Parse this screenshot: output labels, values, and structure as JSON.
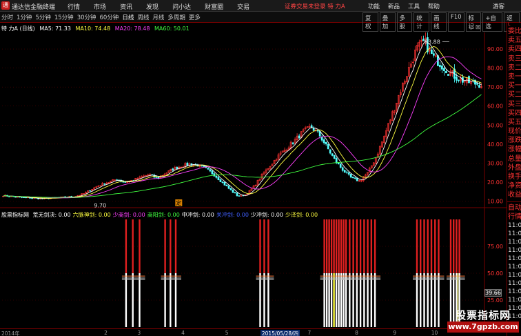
{
  "titlebar": {
    "logo": "通",
    "app_title": "通达信金融终端",
    "menu": [
      "行情",
      "市场",
      "资讯",
      "发现",
      "问小达",
      "财富圈",
      "交易"
    ],
    "notice": "证券交易未登录  特 力A",
    "right_menu": [
      "功能",
      "新品",
      "工具",
      "帮助"
    ],
    "guest": "游客"
  },
  "toolbar": {
    "periods": [
      "分时",
      "1分钟",
      "5分钟",
      "15分钟",
      "30分钟",
      "60分钟",
      "日线",
      "周线",
      "月线",
      "多周期",
      "更多"
    ],
    "active_period": "日线",
    "tools": [
      "复权",
      "叠加",
      "多股",
      "统计",
      "画线",
      "F10",
      "标记",
      "+自选",
      "返回"
    ]
  },
  "main_info": {
    "stock": "特 力A (日线)",
    "ma5": "MA5: 71.33",
    "ma10": "MA10: 74.48",
    "ma20": "MA20: 78.48",
    "ma60": "MA60: 50.01",
    "icons": "◇ ⊠"
  },
  "sub_info": {
    "indicator": "股票指标网",
    "items": [
      {
        "label": "荒无剑决: 0.00",
        "color": "#ffffff"
      },
      {
        "label": "六脉神剑: 0.00",
        "color": "#ffff40"
      },
      {
        "label": "少商剑: 0.00",
        "color": "#ff40ff"
      },
      {
        "label": "商阳剑: 0.00",
        "color": "#40ff40"
      },
      {
        "label": "中冲剑: 0.00",
        "color": "#ffffff"
      },
      {
        "label": "关冲剑: 0.00",
        "color": "#4060ff"
      },
      {
        "label": "少冲剑: 0.00",
        "color": "#ffffff"
      },
      {
        "label": "少泽剑: 0.00",
        "color": "#ffff40"
      }
    ]
  },
  "chart_data": [
    {
      "type": "candlestick",
      "title": "特 力A (日线)",
      "y_ticks": [
        10.0,
        20.0,
        30.0,
        40.0,
        50.0,
        60.0,
        70.0,
        80.0,
        90.0
      ],
      "ylim": [
        8,
        98
      ],
      "annotations": [
        {
          "label": "93.88",
          "value": 93.88
        },
        {
          "label": "9.70",
          "value": 9.7
        },
        {
          "label": "定",
          "value": 0
        }
      ],
      "close_path": [
        13.0,
        12.4,
        12.0,
        11.8,
        11.5,
        11.3,
        11.6,
        11.9,
        12.1,
        12.6,
        14.0,
        16.5,
        18.5,
        20.0,
        21.5,
        19.8,
        21.0,
        22.5,
        24.0,
        22.0,
        24.5,
        27.0,
        28.5,
        29.5,
        29.0,
        27.0,
        24.0,
        20.0,
        16.0,
        12.5,
        13.5,
        18.0,
        24.0,
        29.0,
        34.0,
        38.0,
        42.0,
        46.5,
        49.0,
        45.0,
        38.0,
        31.0,
        26.0,
        22.0,
        20.5,
        25.0,
        33.0,
        44.0,
        56.0,
        68.0,
        79.0,
        90.0,
        93.88,
        86.0,
        82.0,
        78.0,
        75.0,
        73.0,
        72.0,
        71.5
      ],
      "series": [
        {
          "name": "MA5",
          "value": 71.33,
          "color": "#ffffff"
        },
        {
          "name": "MA10",
          "value": 74.48,
          "color": "#ffff40"
        },
        {
          "name": "MA20",
          "value": 78.48,
          "color": "#ff40ff"
        },
        {
          "name": "MA60",
          "value": 50.01,
          "color": "#40ff40"
        }
      ]
    },
    {
      "type": "bar",
      "title": "股票指标网",
      "y_ticks": [
        75.0,
        50.0,
        25.0
      ],
      "ylim": [
        0,
        100
      ],
      "current_value": 39.66,
      "signal_groups": [
        {
          "start": 0.257,
          "end": 0.285,
          "count": 3
        },
        {
          "start": 0.338,
          "end": 0.36,
          "count": 3
        },
        {
          "start": 0.535,
          "end": 0.552,
          "count": 3
        },
        {
          "start": 0.668,
          "end": 0.708,
          "count": 9
        },
        {
          "start": 0.713,
          "end": 0.773,
          "count": 9
        },
        {
          "start": 0.86,
          "end": 0.905,
          "count": 7
        },
        {
          "start": 0.93,
          "end": 0.948,
          "count": 4
        }
      ]
    }
  ],
  "time_axis": [
    {
      "label": "2014年",
      "pos": 0.0
    },
    {
      "label": "2",
      "pos": 0.213
    },
    {
      "label": "3",
      "pos": 0.282
    },
    {
      "label": "4",
      "pos": 0.373
    },
    {
      "label": "5",
      "pos": 0.464
    },
    {
      "label": "2015/05/28/四",
      "pos": 0.537,
      "highlight": true
    },
    {
      "label": "7",
      "pos": 0.635
    },
    {
      "label": "8",
      "pos": 0.733
    },
    {
      "label": "9",
      "pos": 0.812
    },
    {
      "label": "10",
      "pos": 0.891
    }
  ],
  "sidebar": {
    "top_items": [
      "委比",
      "卖五",
      "卖四",
      "卖三",
      "卖二",
      "卖一",
      "买一",
      "买二",
      "买三",
      "买四",
      "买五",
      "现价",
      "涨跌",
      "涨幅",
      "总量",
      "外盘",
      "换手",
      "净资",
      "收益"
    ],
    "mid_items": [
      "自动",
      "行情"
    ],
    "times": [
      "11:08",
      "11:08",
      "11:08",
      "11:08",
      "11:08",
      "11:08",
      "11:08",
      "11:08",
      "11:08",
      "11:08",
      "11:08",
      "11:08"
    ]
  },
  "price_tag": "39.66",
  "watermark": {
    "line1": "股票指标网",
    "line2": "www.7gpzb.com"
  },
  "colors": {
    "up": "#ff3232",
    "down": "#54ffff",
    "axis": "#7a0000",
    "grid": "#600000"
  }
}
